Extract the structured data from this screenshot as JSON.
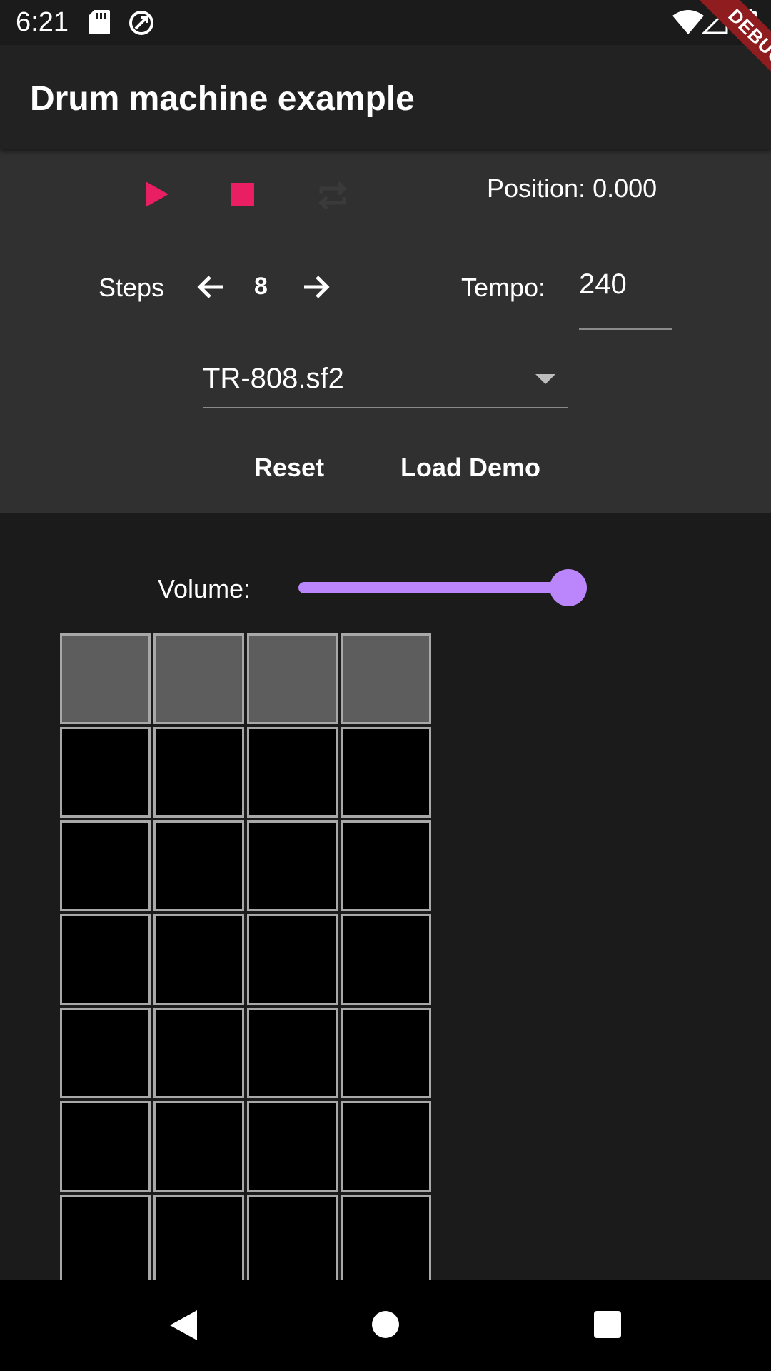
{
  "status_bar": {
    "time": "6:21",
    "icons": [
      "sd-card-icon",
      "sync-icon",
      "wifi-icon",
      "signal-icon",
      "battery-icon"
    ]
  },
  "debug_banner": "DEBUG",
  "app_bar": {
    "title": "Drum machine example"
  },
  "transport": {
    "play_icon": "play-icon",
    "stop_icon": "stop-icon",
    "loop_icon": "repeat-icon",
    "position_text": "Position: 0.000",
    "accent_color": "#e91e63"
  },
  "steps": {
    "label": "Steps",
    "value": "8",
    "prev_icon": "arrow-left-icon",
    "next_icon": "arrow-right-icon"
  },
  "tempo": {
    "label": "Tempo:",
    "value": "240"
  },
  "soundfont": {
    "selected": "TR-808.sf2"
  },
  "actions": {
    "reset_label": "Reset",
    "load_demo_label": "Load Demo"
  },
  "volume": {
    "label": "Volume:",
    "level": 1.0,
    "color": "#bb86fc"
  },
  "grid": {
    "columns": 4,
    "visible_rows": 7,
    "header_color": "#5d5d5d",
    "cell_color": "#000000"
  },
  "nav_bar": {
    "icons": [
      "back-icon",
      "home-icon",
      "recents-icon"
    ]
  }
}
